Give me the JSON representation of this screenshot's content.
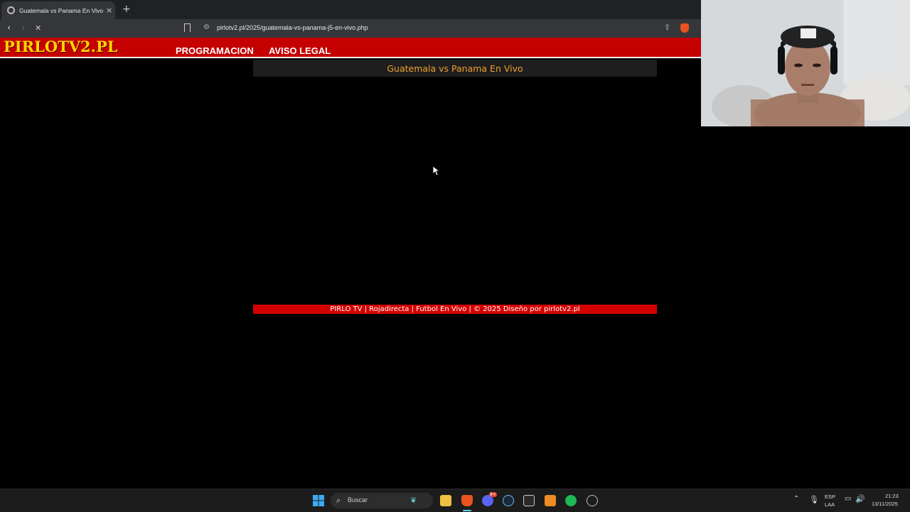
{
  "browser": {
    "tab_title": "Guatemala vs Panama En Vivo | I",
    "tab_close": "×",
    "new_tab": "+",
    "back": "‹",
    "forward": "›",
    "stop": "✕",
    "url": "pirlotv2.pl/2025/guatemala-vs-panama-j5-en-vivo.php"
  },
  "site": {
    "logo": "PIRLOTV2.PL",
    "menu": [
      "PROGRAMACION",
      "AVISO LEGAL"
    ],
    "match_title": "Guatemala vs Panama En Vivo",
    "footer": "PIRLO TV | Rojadirecta | Futbol En Vivo | © 2025 Diseño por pirlotv2.pl"
  },
  "taskbar": {
    "search_placeholder": "Buscar",
    "lang_top": "ESP",
    "lang_bottom": "LAA",
    "time": "21:23",
    "date": "13/11/2025",
    "discord_badge": "9+"
  },
  "colors": {
    "header_red": "#c40000",
    "logo_yellow": "#ffd600",
    "title_orange": "#f0a030"
  }
}
